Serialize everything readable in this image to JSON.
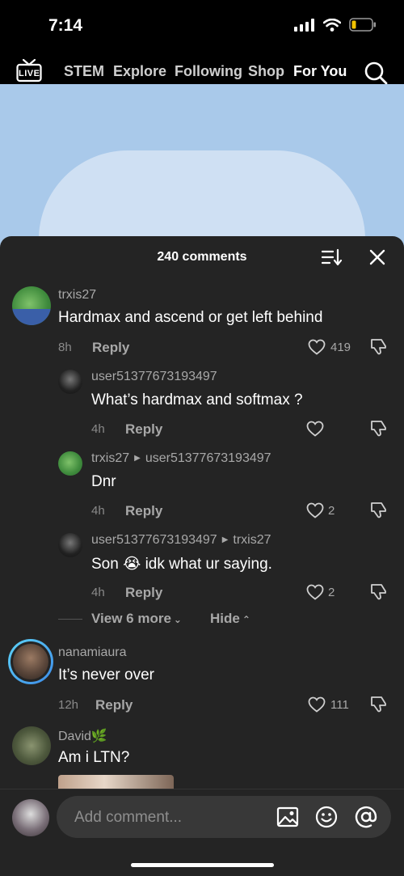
{
  "status": {
    "time": "7:14"
  },
  "nav": {
    "live_label": "LIVE",
    "items": [
      "STEM",
      "Explore",
      "Following",
      "Shop",
      "For You"
    ]
  },
  "comments_sheet": {
    "title": "240 comments",
    "comments": [
      {
        "user": "trxis27",
        "text": "Hardmax and ascend or get left behind",
        "time": "8h",
        "reply": "Reply",
        "likes": "419"
      },
      {
        "user": "user51377673193497",
        "text": "What’s hardmax and softmax ?",
        "time": "4h",
        "reply": "Reply",
        "likes": ""
      },
      {
        "user": "trxis27",
        "reply_to": "user51377673193497",
        "text": "Dnr",
        "time": "4h",
        "reply": "Reply",
        "likes": "2"
      },
      {
        "user": "user51377673193497",
        "reply_to": "trxis27",
        "text": "Son 😭 idk what ur saying.",
        "time": "4h",
        "reply": "Reply",
        "likes": "2"
      },
      {
        "user": "nanamiaura",
        "text": "It’s never over",
        "time": "12h",
        "reply": "Reply",
        "likes": "111"
      },
      {
        "user": "David🌿",
        "text": "Am i LTN?"
      }
    ],
    "view_more": "View 6 more",
    "hide": "Hide"
  },
  "composer": {
    "placeholder": "Add comment..."
  }
}
